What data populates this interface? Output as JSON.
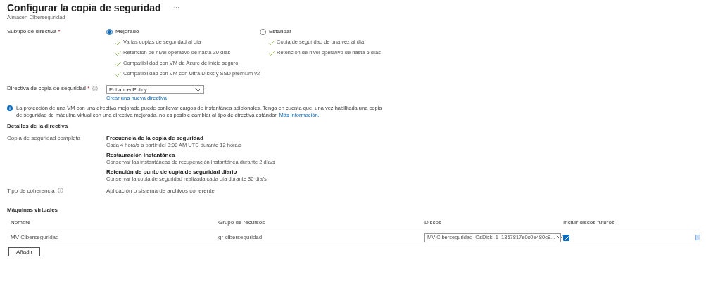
{
  "header": {
    "title": "Configurar la copia de seguridad",
    "more": "···",
    "subtitle": "Almacen-Ciberseguridad"
  },
  "subtype": {
    "label": "Subtipo de directiva",
    "required": "*",
    "options": [
      {
        "label": "Mejorado",
        "selected": true,
        "features": [
          "Varias copias de seguridad al día",
          "Retención de nivel operativo de hasta 30 días",
          "Compatibilidad con VM de Azure de inicio seguro",
          "Compatibilidad con VM con Ultra Disks y SSD prémium v2"
        ]
      },
      {
        "label": "Estándar",
        "selected": false,
        "features": [
          "Copia de seguridad de una vez al día",
          "Retención de nivel operativo de hasta 5 días"
        ]
      }
    ]
  },
  "policy": {
    "label": "Directiva de copia de seguridad",
    "required": "*",
    "value": "EnhancedPolicy",
    "link": "Crear una nueva directiva"
  },
  "info": {
    "text": "La protección de una VM con una directiva mejorada puede conllevar cargos de instantánea adicionales. Tenga en cuenta que, una vez habilitada una copia de seguridad de máquina virtual con una directiva mejorada, no es posible cambiar al tipo de directiva estándar.",
    "link": "Más información."
  },
  "details": {
    "title": "Detalles de la directiva",
    "rows": [
      {
        "label": "Copia de seguridad completa",
        "info": false,
        "items": [
          {
            "heading": "Frecuencia de la copia de seguridad",
            "text": "Cada 4 hora/s a partir del 8:00 AM UTC durante 12 hora/s"
          },
          {
            "heading": "Restauración instantánea",
            "text": "Conservar las instantáneas de recuperación instantánea durante 2 día/s"
          },
          {
            "heading": "Retención de punto de copia de seguridad diario",
            "text": "Conservar la copia de seguridad realizada cada día durante 30 día/s"
          }
        ]
      },
      {
        "label": "Tipo de coherencia",
        "info": true,
        "value": "Aplicación o sistema de archivos coherente"
      }
    ]
  },
  "vms": {
    "title": "Máquinas virtuales",
    "columns": [
      "Nombre",
      "Grupo de recursos",
      "Discos",
      "Incluir discos futuros"
    ],
    "rows": [
      {
        "name": "MV-Ciberseguridad",
        "group": "gr-ciberseguridad",
        "disks": "MV-Ciberseguridad_OsDisk_1_1357817e0c0e480c8...",
        "include_future": true
      }
    ],
    "add_button": "Añadir"
  }
}
